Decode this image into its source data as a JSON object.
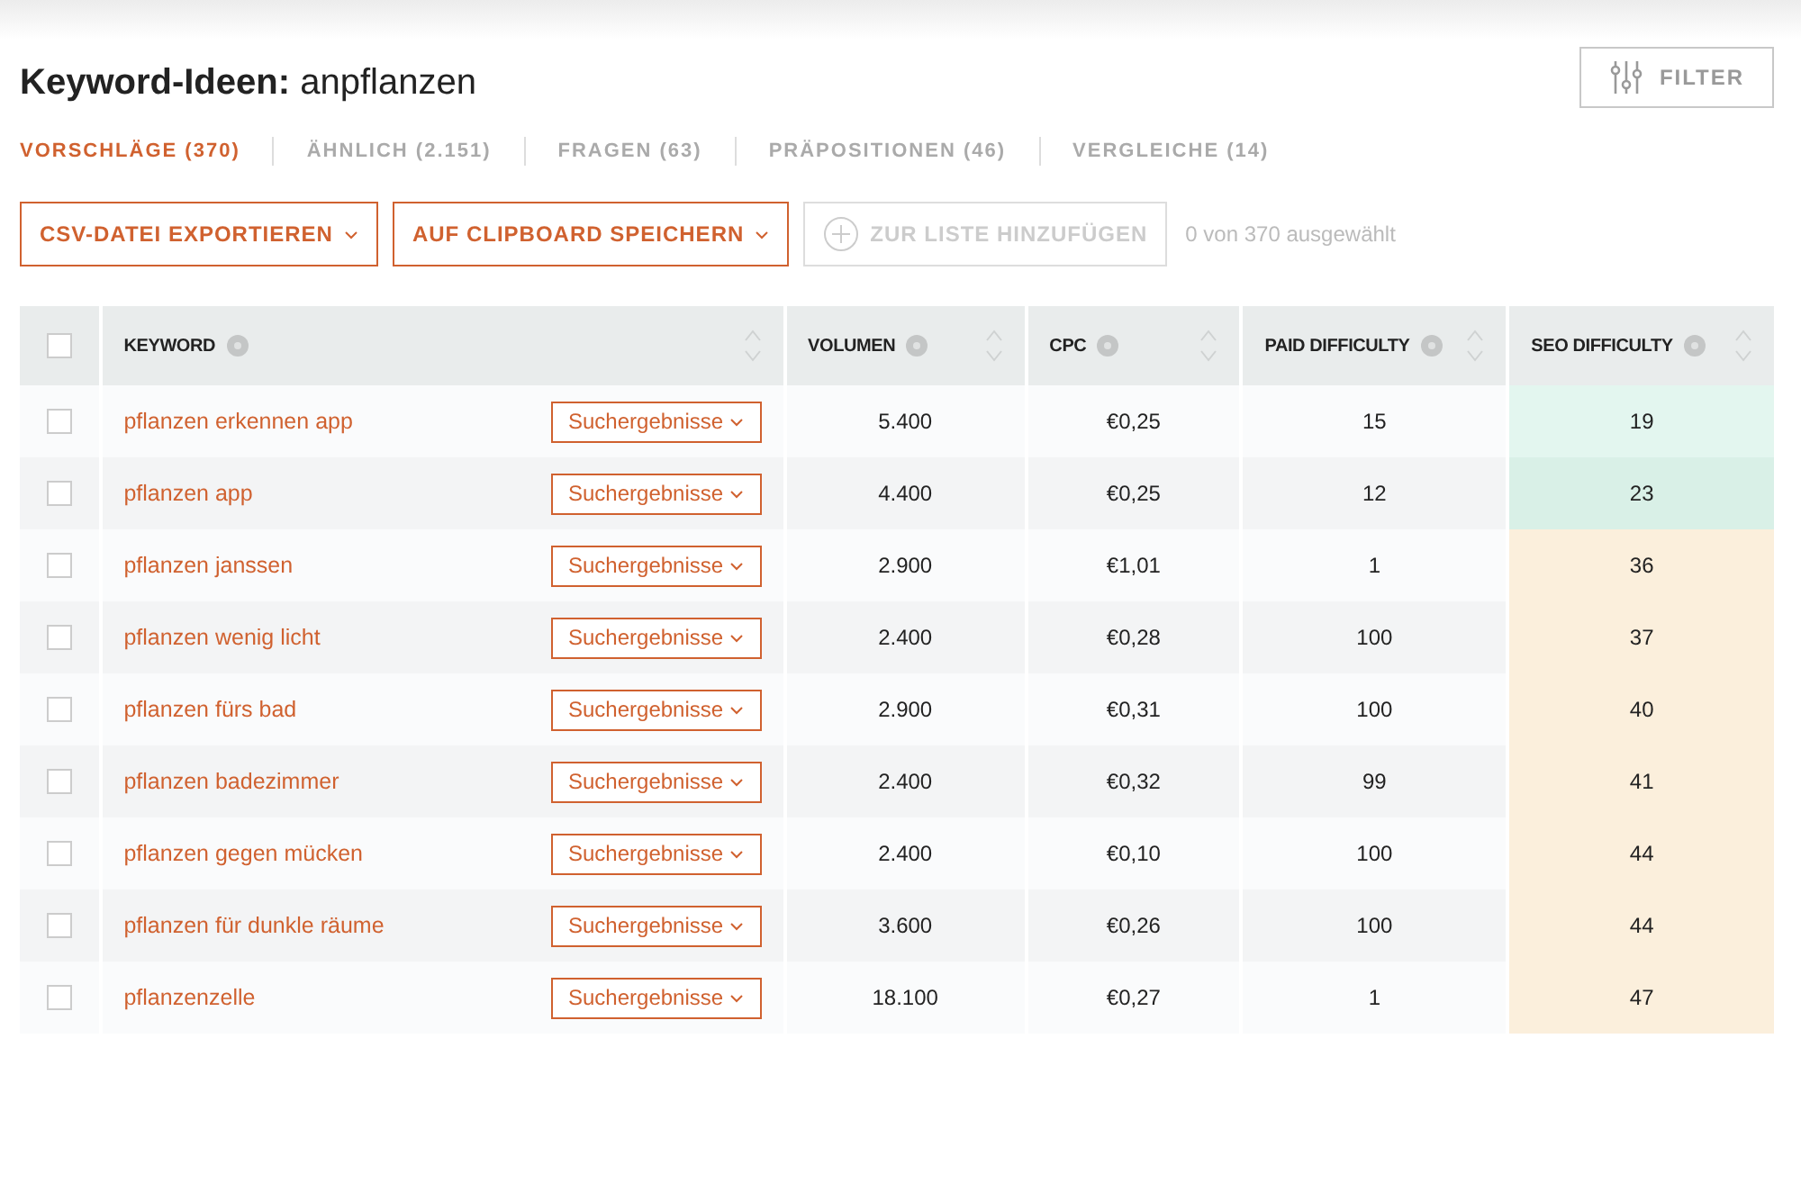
{
  "header": {
    "title_bold": "Keyword-Ideen:",
    "title_query": "anpflanzen",
    "filter_button": "FILTER"
  },
  "tabs": [
    {
      "label": "VORSCHLÄGE (370)",
      "selected": true
    },
    {
      "label": "ÄHNLICH (2.151)",
      "selected": false
    },
    {
      "label": "FRAGEN (63)",
      "selected": false
    },
    {
      "label": "PRÄPOSITIONEN (46)",
      "selected": false
    },
    {
      "label": "VERGLEICHE (14)",
      "selected": false
    }
  ],
  "actions": [
    {
      "label": "CSV-DATEI EXPORTIEREN",
      "kind": "dropdown",
      "disabled": false
    },
    {
      "label": "AUF CLIPBOARD SPEICHERN",
      "kind": "dropdown",
      "disabled": false
    },
    {
      "label": "ZUR LISTE HINZUFÜGEN",
      "kind": "add",
      "disabled": true
    }
  ],
  "selection_count": "0 von 370 ausgewählt",
  "table": {
    "select_all_checked": false,
    "columns": [
      {
        "label": "KEYWORD"
      },
      {
        "label": "VOLUMEN"
      },
      {
        "label": "CPC"
      },
      {
        "label": "PAID DIFFICULTY"
      },
      {
        "label": "SEO DIFFICULTY"
      }
    ],
    "rows": [
      {
        "checked": false,
        "keyword": "pflanzen erkennen app",
        "serp": "Suchergebnisse",
        "volume": "5.400",
        "cpc": "€0,25",
        "paid": "15",
        "seo": "19",
        "color": "#e3f6ef"
      },
      {
        "checked": false,
        "keyword": "pflanzen app",
        "serp": "Suchergebnisse",
        "volume": "4.400",
        "cpc": "€0,25",
        "paid": "12",
        "seo": "23",
        "color": "#d9f0e7"
      },
      {
        "checked": false,
        "keyword": "pflanzen janssen",
        "serp": "Suchergebnisse",
        "volume": "2.900",
        "cpc": "€1,01",
        "paid": "1",
        "seo": "36",
        "color": "#fbefdc"
      },
      {
        "checked": false,
        "keyword": "pflanzen wenig licht",
        "serp": "Suchergebnisse",
        "volume": "2.400",
        "cpc": "€0,28",
        "paid": "100",
        "seo": "37",
        "color": "#fbefdc"
      },
      {
        "checked": false,
        "keyword": "pflanzen fürs bad",
        "serp": "Suchergebnisse",
        "volume": "2.900",
        "cpc": "€0,31",
        "paid": "100",
        "seo": "40",
        "color": "#fbefdc"
      },
      {
        "checked": false,
        "keyword": "pflanzen badezimmer",
        "serp": "Suchergebnisse",
        "volume": "2.400",
        "cpc": "€0,32",
        "paid": "99",
        "seo": "41",
        "color": "#fbefdc"
      },
      {
        "checked": false,
        "keyword": "pflanzen gegen mücken",
        "serp": "Suchergebnisse",
        "volume": "2.400",
        "cpc": "€0,10",
        "paid": "100",
        "seo": "44",
        "color": "#fbefdc"
      },
      {
        "checked": false,
        "keyword": "pflanzen für dunkle räume",
        "serp": "Suchergebnisse",
        "volume": "3.600",
        "cpc": "€0,26",
        "paid": "100",
        "seo": "44",
        "color": "#fbefdc"
      },
      {
        "checked": false,
        "keyword": "pflanzenzelle",
        "serp": "Suchergebnisse",
        "volume": "18.100",
        "cpc": "€0,27",
        "paid": "1",
        "seo": "47",
        "color": "#fbefdc"
      }
    ]
  }
}
